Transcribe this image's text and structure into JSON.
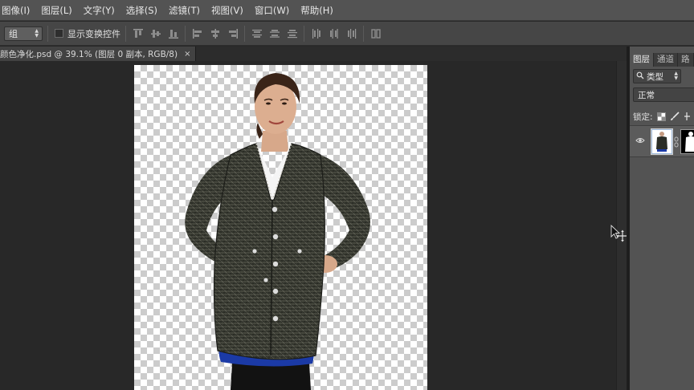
{
  "menu": {
    "items": [
      "图像(I)",
      "图层(L)",
      "文字(Y)",
      "选择(S)",
      "滤镜(T)",
      "视图(V)",
      "窗口(W)",
      "帮助(H)"
    ]
  },
  "options_bar": {
    "auto_select_value": "组",
    "show_transform_label": "显示变换控件"
  },
  "document": {
    "tab_title": "颜色净化.psd @ 39.1% (图层 0 副本, RGB/8)",
    "tab_close": "×"
  },
  "layers_panel": {
    "tabs": [
      "图层",
      "通道",
      "路"
    ],
    "filter_value": "类型",
    "blend_mode": "正常",
    "lock_label": "锁定:"
  },
  "colors": {
    "menubar_bg": "#535353",
    "optionsbar_bg": "#464646",
    "canvas_bg": "#282828",
    "panel_bg": "#535353",
    "jacket": "#2b2d26",
    "skirt": "#1b3aa6"
  },
  "icons": {
    "cursor": "move-cursor-icon",
    "eye": "eye-icon",
    "chain": "link-icon"
  }
}
